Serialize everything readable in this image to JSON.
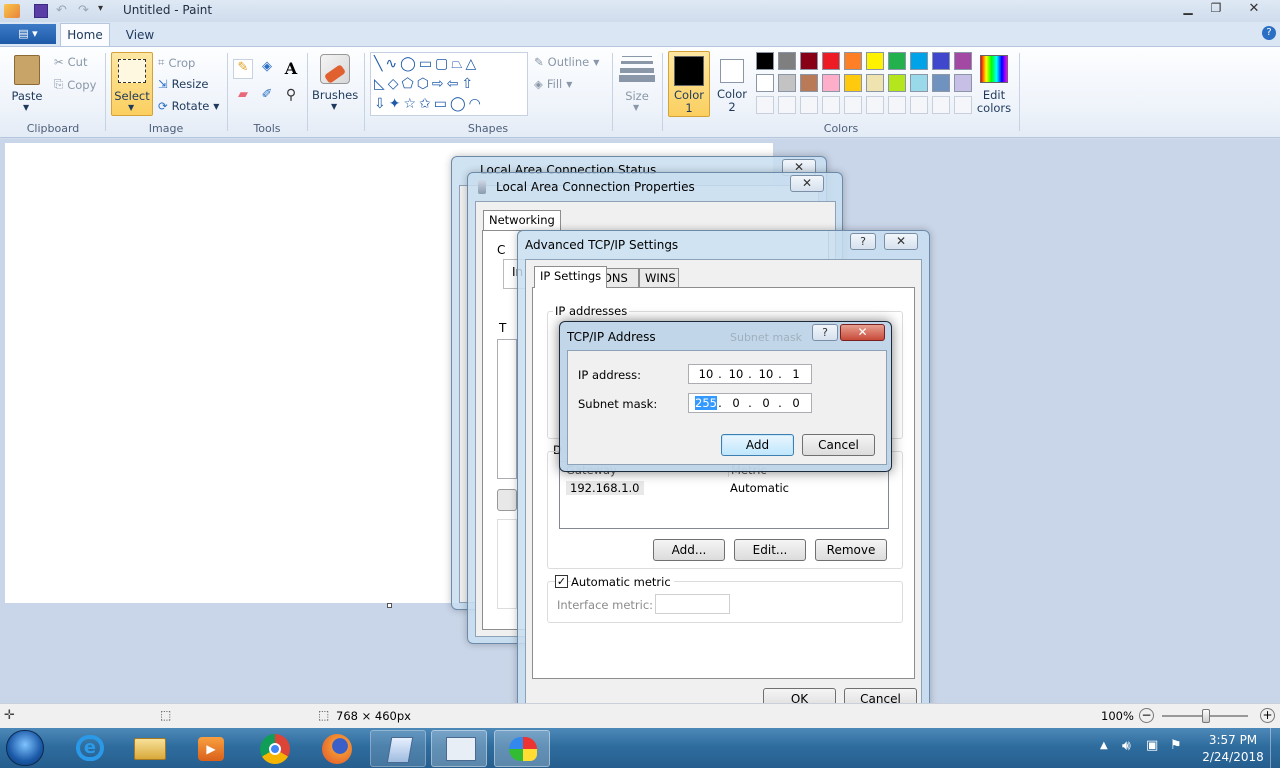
{
  "app": {
    "title": "Untitled - Paint"
  },
  "ribbon_tabs": {
    "file_menu": "▤ ▾",
    "home": "Home",
    "view": "View"
  },
  "clipboard": {
    "paste": "Paste",
    "cut": "Cut",
    "copy": "Copy",
    "label": "Clipboard"
  },
  "image": {
    "select": "Select",
    "crop": "Crop",
    "resize": "Resize",
    "rotate": "Rotate",
    "label": "Image"
  },
  "tools": {
    "label": "Tools"
  },
  "brushes": {
    "label": "Brushes"
  },
  "shapes": {
    "outline": "Outline",
    "fill": "Fill",
    "label": "Shapes"
  },
  "size": {
    "label": "Size"
  },
  "colors": {
    "color1": "Color 1",
    "color2": "Color 2",
    "edit": "Edit colors",
    "label": "Colors",
    "color1_value": "#000000",
    "color2_value": "#ffffff",
    "palette_row1": [
      "#000000",
      "#7f7f7f",
      "#880015",
      "#ed1c24",
      "#ff7f27",
      "#fff200",
      "#22b14c",
      "#00a2e8",
      "#3f48cc",
      "#a349a4"
    ],
    "palette_row2": [
      "#ffffff",
      "#c3c3c3",
      "#b97a57",
      "#ffaec9",
      "#ffc90e",
      "#efe4b0",
      "#b5e61d",
      "#99d9ea",
      "#7092be",
      "#c8bfe7"
    ]
  },
  "status_win": {
    "title": "Local Area Connection Status"
  },
  "props_win": {
    "title": "Local Area Connection Properties",
    "tab": "Networking",
    "frag1": "C",
    "frag2": "In",
    "frag3": "T"
  },
  "adv_win": {
    "title": "Advanced TCP/IP Settings",
    "tabs": [
      "IP Settings",
      "DNS",
      "WINS"
    ],
    "ip_group": "IP addresses",
    "gw_group_frag": "D",
    "gw_col_gateway": "Gateway",
    "gw_col_metric": "Metric",
    "gw_row_gateway": "192.168.1.0",
    "gw_row_metric": "Automatic",
    "add": "Add...",
    "edit": "Edit...",
    "remove": "Remove",
    "auto_metric": "Automatic metric",
    "iface_metric": "Interface metric:",
    "ok": "OK",
    "cancel": "Cancel"
  },
  "tcpip_dlg": {
    "title": "TCP/IP Address",
    "ip_label": "IP address:",
    "ip": [
      "10",
      "10",
      "10",
      "1"
    ],
    "mask_label": "Subnet mask:",
    "mask": [
      "255",
      "0",
      "0",
      "0"
    ],
    "add": "Add",
    "cancel": "Cancel",
    "behind_text": "Subnet mask"
  },
  "status_bar": {
    "dimensions": "768 × 460px",
    "zoom": "100%"
  },
  "taskbar": {
    "time": "3:57 PM",
    "date": "2/24/2018"
  }
}
